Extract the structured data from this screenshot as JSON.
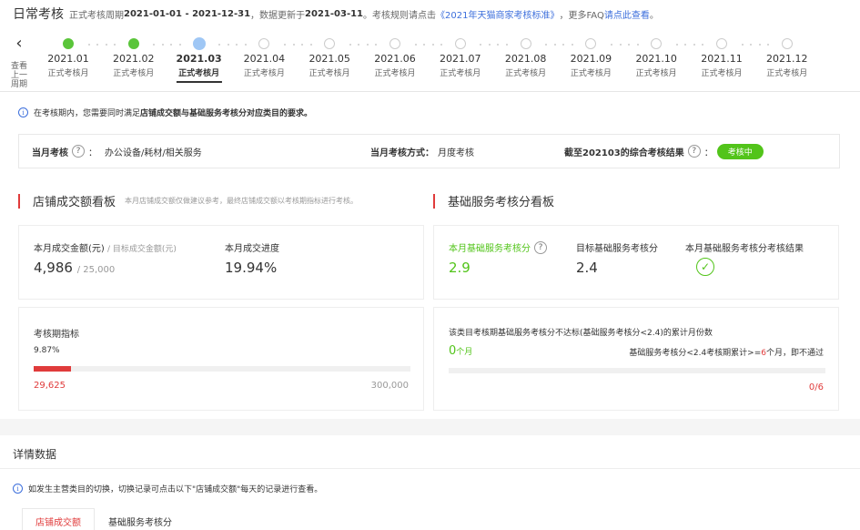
{
  "header": {
    "title": "日常考核",
    "period_prefix": "正式考核周期",
    "period": "2021-01-01 - 2021-12-31",
    "updated_prefix": "，数据更新于",
    "updated": "2021-03-11",
    "rule_prefix": "。考核规则请点击",
    "rule_link": "《2021年天猫商家考核标准》",
    "faq_prefix": "，更多FAQ",
    "faq_link": "请点此查看",
    "faq_suffix": "。"
  },
  "timeline": {
    "back_label": "查看上一周期",
    "months": [
      {
        "m": "2021.01",
        "s": "正式考核月",
        "state": "done"
      },
      {
        "m": "2021.02",
        "s": "正式考核月",
        "state": "done"
      },
      {
        "m": "2021.03",
        "s": "正式考核月",
        "state": "current"
      },
      {
        "m": "2021.04",
        "s": "正式考核月",
        "state": "future"
      },
      {
        "m": "2021.05",
        "s": "正式考核月",
        "state": "future"
      },
      {
        "m": "2021.06",
        "s": "正式考核月",
        "state": "future"
      },
      {
        "m": "2021.07",
        "s": "正式考核月",
        "state": "future"
      },
      {
        "m": "2021.08",
        "s": "正式考核月",
        "state": "future"
      },
      {
        "m": "2021.09",
        "s": "正式考核月",
        "state": "future"
      },
      {
        "m": "2021.10",
        "s": "正式考核月",
        "state": "future"
      },
      {
        "m": "2021.11",
        "s": "正式考核月",
        "state": "future"
      },
      {
        "m": "2021.12",
        "s": "正式考核月",
        "state": "future"
      }
    ]
  },
  "notice": {
    "prefix": "在考核期内，您需要同时满足",
    "bold": "店铺成交额与基础服务考核分对应类目的要求。"
  },
  "assessment": {
    "month_label": "当月考核",
    "month_value": "办公设备/耗材/相关服务",
    "method_label": "当月考核方式：",
    "method_value": "月度考核",
    "result_label": "截至202103的综合考核结果",
    "result_badge": "考核中"
  },
  "sales_board": {
    "title": "店铺成交额看板",
    "subtitle": "本月店铺成交额仅做建议参考，最终店铺成交额以考核期指标进行考核。",
    "amount_label": "本月成交金额(元)",
    "target_label": "/ 目标成交金额(元)",
    "amount": "4,986",
    "target": "/ 25,000",
    "progress_label": "本月成交进度",
    "progress_value": "19.94%",
    "period_label": "考核期指标",
    "period_pct": "9.87%",
    "period_fill": 0.0987,
    "period_current": "29,625",
    "period_target": "300,000"
  },
  "service_board": {
    "title": "基础服务考核分看板",
    "score_label": "本月基础服务考核分",
    "score": "2.9",
    "target_label": "目标基础服务考核分",
    "target": "2.4",
    "result_label": "本月基础服务考核分考核结果",
    "fail_desc": "该类目考核期基础服务考核分不达标(基础服务考核分<2.4)的累计月份数",
    "fail_count": "0",
    "fail_unit": "个月",
    "rule_prefix": "基础服务考核分<2.4考核期累计>=",
    "rule_num": "6",
    "rule_suffix": "个月，即不通过",
    "fail_fill": 0,
    "fail_ratio": "0/6"
  },
  "detail": {
    "title": "详情数据",
    "note": "如发生主营类目的切换，切换记录可点击以下\"店铺成交额\"每天的记录进行查看。",
    "tabs": [
      "店铺成交额",
      "基础服务考核分"
    ]
  },
  "colors": {
    "accent_red": "#e03b3b",
    "green": "#52c41a",
    "link_blue": "#3d6fdc"
  }
}
